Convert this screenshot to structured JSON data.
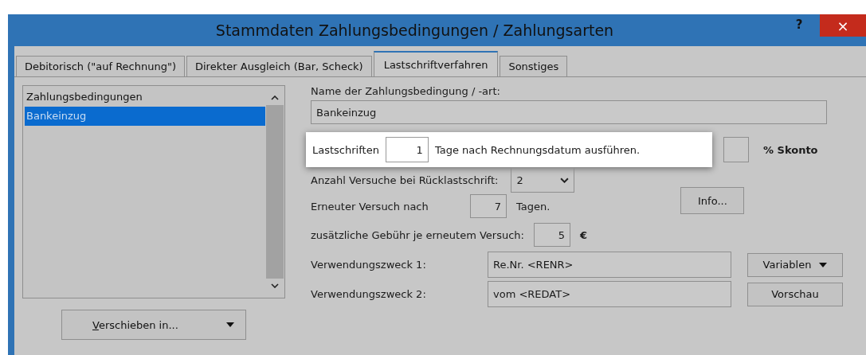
{
  "window": {
    "title": "Stammdaten Zahlungsbedingungen / Zahlungsarten",
    "help": "?",
    "close": "×"
  },
  "tabs": [
    {
      "label": "Debitorisch (\"auf Rechnung\")",
      "selected": false
    },
    {
      "label": "Direkter Ausgleich (Bar, Scheck)",
      "selected": false
    },
    {
      "label": "Lastschriftverfahren",
      "selected": true
    },
    {
      "label": "Sonstiges",
      "selected": false
    }
  ],
  "list": {
    "header": "Zahlungsbedingungen",
    "items": [
      {
        "label": "Bankeinzug",
        "selected": true
      }
    ]
  },
  "move_button": {
    "label": "Verschieben in..."
  },
  "form": {
    "name_label": "Name der Zahlungsbedingung / -art:",
    "name_value": "Bankeinzug",
    "debit_label": "Lastschriften",
    "debit_days": "1",
    "debit_suffix": "Tage nach Rechnungsdatum ausführen.",
    "skonto_label": "% Skonto",
    "attempts_label": "Anzahl Versuche bei Rücklastschrift:",
    "attempts_value": "2",
    "retry_label": "Erneuter Versuch nach",
    "retry_days": "7",
    "retry_suffix": "Tagen.",
    "info_button": "Info...",
    "fee_label": "zusätzliche Gebühr je erneutem Versuch:",
    "fee_value": "5",
    "fee_unit": "€",
    "purpose1_label": "Verwendungszweck 1:",
    "purpose1_value": "Re.Nr. <RENR>",
    "purpose2_label": "Verwendungszweck 2:",
    "purpose2_value": "vom <REDAT>",
    "variables_button": "Variablen",
    "preview_button": "Vorschau"
  }
}
